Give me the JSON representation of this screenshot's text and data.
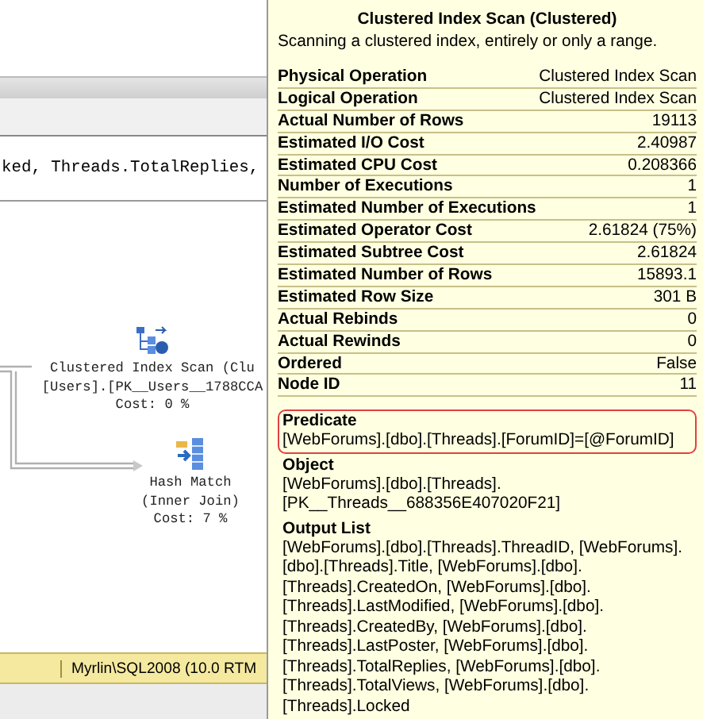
{
  "sql_text": "ked, Threads.TotalReplies,",
  "plan_nodes": [
    {
      "kind": "clustered_index_scan",
      "lines": [
        "Clustered Index Scan (Clu",
        "[Users].[PK__Users__1788CCA",
        "Cost: 0 %"
      ]
    },
    {
      "kind": "hash_match",
      "lines": [
        "Hash Match",
        "(Inner Join)",
        "Cost: 7 %"
      ]
    }
  ],
  "status_bar": {
    "server": "Myrlin\\SQL2008 (10.0 RTM"
  },
  "tooltip": {
    "title": "Clustered Index Scan (Clustered)",
    "description": "Scanning a clustered index, entirely or only a range.",
    "properties": [
      {
        "name": "Physical Operation",
        "value": "Clustered Index Scan"
      },
      {
        "name": "Logical Operation",
        "value": "Clustered Index Scan"
      },
      {
        "name": "Actual Number of Rows",
        "value": "19113"
      },
      {
        "name": "Estimated I/O Cost",
        "value": "2.40987"
      },
      {
        "name": "Estimated CPU Cost",
        "value": "0.208366"
      },
      {
        "name": "Number of Executions",
        "value": "1"
      },
      {
        "name": "Estimated Number of Executions",
        "value": "1"
      },
      {
        "name": "Estimated Operator Cost",
        "value": "2.61824 (75%)"
      },
      {
        "name": "Estimated Subtree Cost",
        "value": "2.61824"
      },
      {
        "name": "Estimated Number of Rows",
        "value": "15893.1"
      },
      {
        "name": "Estimated Row Size",
        "value": "301 B"
      },
      {
        "name": "Actual Rebinds",
        "value": "0"
      },
      {
        "name": "Actual Rewinds",
        "value": "0"
      },
      {
        "name": "Ordered",
        "value": "False"
      },
      {
        "name": "Node ID",
        "value": "11"
      }
    ],
    "sections": [
      {
        "heading": "Predicate",
        "text": "[WebForums].[dbo].[Threads].[ForumID]=[@ForumID]",
        "highlighted": true
      },
      {
        "heading": "Object",
        "text": "[WebForums].[dbo].[Threads].[PK__Threads__688356E407020F21]",
        "highlighted": false
      },
      {
        "heading": "Output List",
        "text": "[WebForums].[dbo].[Threads].ThreadID, [WebForums].[dbo].[Threads].Title, [WebForums].[dbo].[Threads].CreatedOn, [WebForums].[dbo].[Threads].LastModified, [WebForums].[dbo].[Threads].CreatedBy, [WebForums].[dbo].[Threads].LastPoster, [WebForums].[dbo].[Threads].TotalReplies, [WebForums].[dbo].[Threads].TotalViews, [WebForums].[dbo].[Threads].Locked",
        "highlighted": false
      }
    ]
  }
}
